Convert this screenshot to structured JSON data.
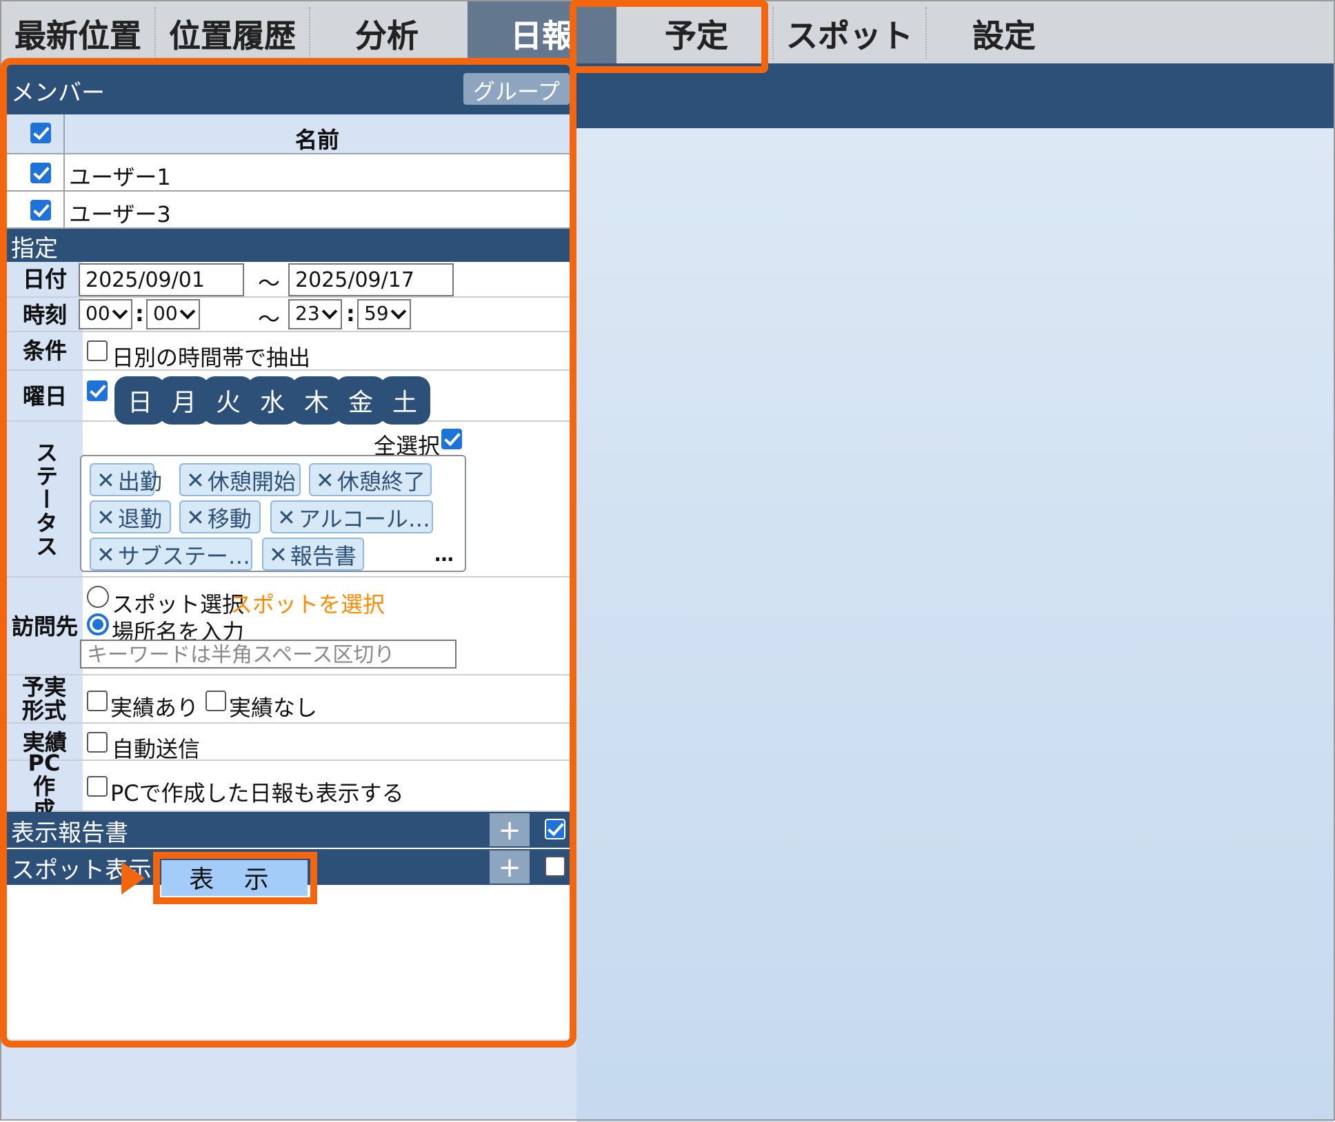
{
  "tabs": [
    {
      "label": "最新位置",
      "active": false
    },
    {
      "label": "位置履歴",
      "active": false
    },
    {
      "label": "分析",
      "active": false
    },
    {
      "label": "日報",
      "active": true
    },
    {
      "label": "予定",
      "active": false
    },
    {
      "label": "スポット",
      "active": false
    },
    {
      "label": "設定",
      "active": false
    }
  ],
  "members": {
    "title": "メンバー",
    "group_button": "グループ",
    "column_name": "名前",
    "all_checked": true,
    "rows": [
      {
        "name": "ユーザー1",
        "checked": true
      },
      {
        "name": "ユーザー3",
        "checked": true
      }
    ]
  },
  "spec": {
    "title": "指定",
    "date": {
      "label": "日付",
      "from": "2025/09/01",
      "sep": "～",
      "to": "2025/09/17"
    },
    "time": {
      "label": "時刻",
      "from_h": "00",
      "from_m": "00",
      "colon": ":",
      "sep": "～",
      "to_h": "23",
      "to_m": "59"
    },
    "condition": {
      "label": "条件",
      "option": "日別の時間帯で抽出",
      "checked": false
    },
    "weekday": {
      "label": "曜日",
      "checked": true,
      "days": [
        "日",
        "月",
        "火",
        "水",
        "木",
        "金",
        "土"
      ]
    },
    "status": {
      "label": "ステータス",
      "select_all": "全選択",
      "select_all_checked": true,
      "chip_x": "✕",
      "chips": [
        "出勤",
        "休憩開始",
        "休憩終了",
        "退勤",
        "移動",
        "アルコール…",
        "サブステー…",
        "報告書"
      ],
      "more": "…"
    },
    "visit": {
      "label": "訪問先",
      "spot_option": "スポット選択",
      "spot_link": "スポットを選択",
      "name_option": "場所名を入力",
      "selected": "name",
      "keyword_placeholder": "キーワードは半角スペース区切り"
    },
    "plan": {
      "label": "予実形式",
      "opt1": "実績あり",
      "opt2": "実績なし"
    },
    "actual": {
      "label": "実績",
      "opt": "自動送信"
    },
    "pc": {
      "label": "PC作成",
      "opt": "PCで作成した日報も表示する"
    }
  },
  "report_display": {
    "title": "表示報告書",
    "plus": "+",
    "checked": true
  },
  "spot_display": {
    "title": "スポット表示",
    "plus": "+",
    "checked": false
  },
  "show_button": "表 示",
  "colors": {
    "header": "#2d5079",
    "highlight": "#f26610",
    "accent": "#1f73d8"
  }
}
